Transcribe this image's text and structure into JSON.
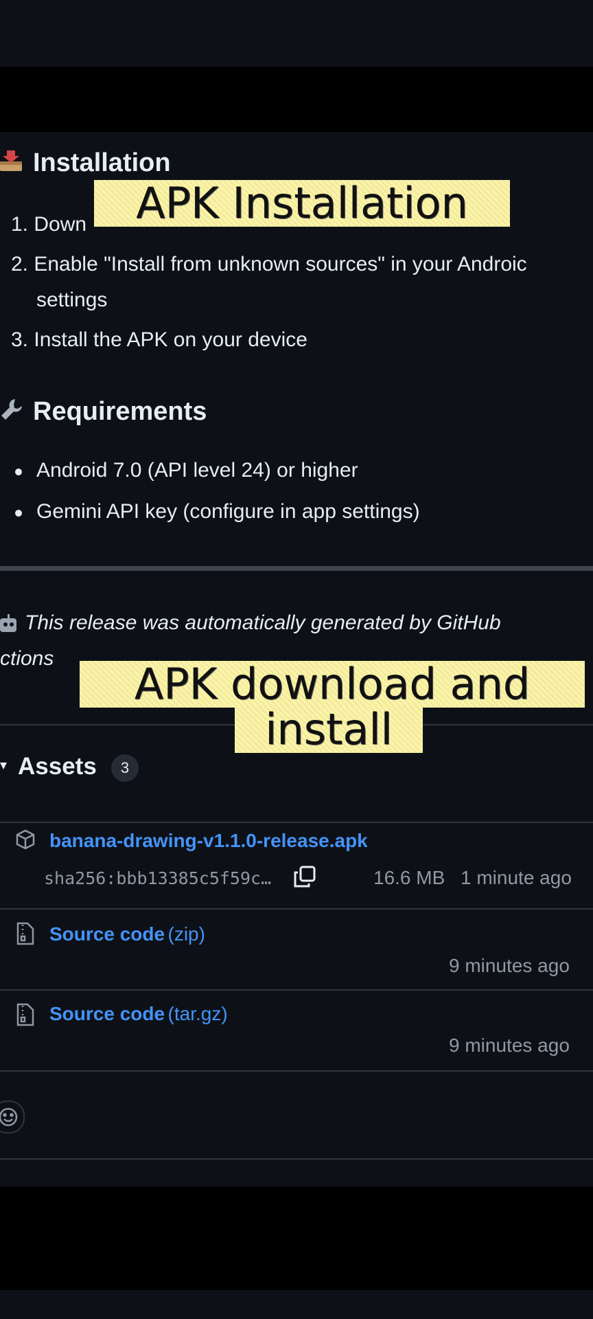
{
  "installation": {
    "title": "Installation",
    "step1": "1. Down",
    "step2_line1": "2. Enable \"Install from unknown sources\" in your Androic",
    "step2_line2": "settings",
    "step3": "3. Install the APK on your device"
  },
  "requirements": {
    "title": "Requirements",
    "items": [
      "Android 7.0 (API level 24) or higher",
      "Gemini API key (configure in app settings)"
    ]
  },
  "release_note": {
    "line1": "This release was automatically generated by GitHub",
    "line2": "ctions"
  },
  "assets": {
    "title": "Assets",
    "count": "3",
    "files": [
      {
        "name": "banana-drawing-v1.1.0-release.apk",
        "sha": "sha256:bbb13385c5f59c…",
        "size": "16.6 MB",
        "time": "1 minute ago"
      },
      {
        "name": "Source code",
        "ext": "(zip)",
        "time": "9 minutes ago"
      },
      {
        "name": "Source code",
        "ext": "(tar.gz)",
        "time": "9 minutes ago"
      }
    ]
  },
  "overlays": {
    "top": "APK Installation",
    "bottom_line1": "APK download and",
    "bottom_line2": "install"
  },
  "icons": {
    "installation": "inbox-tray-icon",
    "requirements": "wrench-icon",
    "robot": "robot-icon",
    "package": "package-icon",
    "zip": "file-zip-icon",
    "copy": "copy-icon",
    "smiley": "smiley-icon",
    "caret": "triangle-down-icon"
  },
  "colors": {
    "background": "#0d1117",
    "link": "#4493f8",
    "muted": "#9198a1",
    "overlay": "#fbf3a6"
  }
}
